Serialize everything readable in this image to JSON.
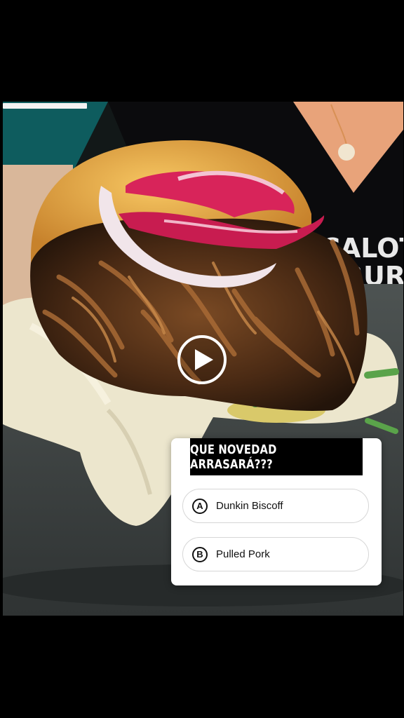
{
  "media": {
    "kind": "video",
    "story_progress_percent": 21,
    "background_sign_text": [
      "CALOT",
      "BURG"
    ]
  },
  "player": {
    "play_icon": "play-icon"
  },
  "poll": {
    "question": "QUE NOVEDAD ARRASARÁ???",
    "options": [
      {
        "letter": "A",
        "label": "Dunkin Biscoff"
      },
      {
        "letter": "B",
        "label": "Pulled Pork"
      }
    ]
  },
  "colors": {
    "poll_header_bg": "#000000",
    "poll_body_bg": "#ffffff",
    "option_border": "#d6d6d6"
  }
}
